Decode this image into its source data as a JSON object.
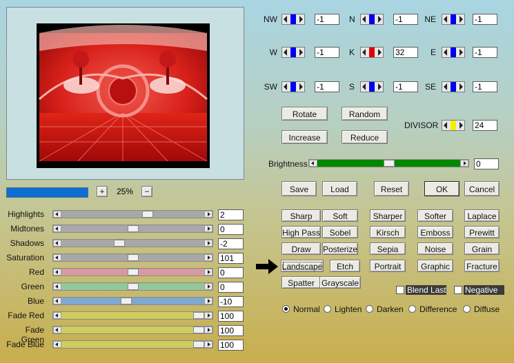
{
  "colors": {
    "accent_blue": "#0000ee",
    "center_red": "#e00000",
    "divisor_yellow": "#f4ee00",
    "brightness_green": "#008800",
    "progress_blue": "#0a6fd4",
    "slider_gray": "#a8a8a8",
    "slider_red": "#d69aa0",
    "slider_green": "#93c99a",
    "slider_blue": "#7fa8d0",
    "slider_fade": "#cfcd5c"
  },
  "preview": {
    "zoom_value": "25%",
    "zoom_plus": "+",
    "zoom_minus": "−",
    "progress": 1.0
  },
  "matrix": [
    {
      "label": "NW",
      "value": "-1",
      "thumb": "blue"
    },
    {
      "label": "N",
      "value": "-1",
      "thumb": "blue"
    },
    {
      "label": "NE",
      "value": "-1",
      "thumb": "blue"
    },
    {
      "label": "W",
      "value": "-1",
      "thumb": "blue"
    },
    {
      "label": "K",
      "value": "32",
      "thumb": "red"
    },
    {
      "label": "E",
      "value": "-1",
      "thumb": "blue"
    },
    {
      "label": "SW",
      "value": "-1",
      "thumb": "blue"
    },
    {
      "label": "S",
      "value": "-1",
      "thumb": "blue"
    },
    {
      "label": "SE",
      "value": "-1",
      "thumb": "blue"
    }
  ],
  "divisor": {
    "label": "DIVISOR",
    "value": "24"
  },
  "buttons": {
    "rotate": "Rotate",
    "random": "Random",
    "increase": "Increase",
    "reduce": "Reduce",
    "save": "Save",
    "load": "Load",
    "reset": "Reset",
    "ok": "OK",
    "cancel": "Cancel"
  },
  "brightness": {
    "label": "Brightness",
    "value": "0",
    "level": 0.5
  },
  "adjust": [
    {
      "label": "Highlights",
      "value": "2",
      "level": 0.61,
      "track": "slider_gray"
    },
    {
      "label": "Midtones",
      "value": "0",
      "level": 0.5,
      "track": "slider_gray"
    },
    {
      "label": "Shadows",
      "value": "-2",
      "level": 0.4,
      "track": "slider_gray"
    },
    {
      "label": "Saturation",
      "value": "101",
      "level": 0.5,
      "track": "slider_gray"
    },
    {
      "label": "Red",
      "value": "0",
      "level": 0.5,
      "track": "slider_red"
    },
    {
      "label": "Green",
      "value": "0",
      "level": 0.5,
      "track": "slider_green"
    },
    {
      "label": "Blue",
      "value": "-10",
      "level": 0.45,
      "track": "slider_blue"
    },
    {
      "label": "Fade Red",
      "value": "100",
      "level": 1.0,
      "track": "slider_fade"
    },
    {
      "label": "Fade Green",
      "value": "100",
      "level": 1.0,
      "track": "slider_fade"
    },
    {
      "label": "Fade Blue",
      "value": "100",
      "level": 1.0,
      "track": "slider_fade"
    }
  ],
  "presets": [
    [
      "Sharp",
      "Soft",
      "Sharper",
      "Softer",
      "Laplace"
    ],
    [
      "High Pass",
      "Sobel",
      "Kirsch",
      "Emboss",
      "Prewitt"
    ],
    [
      "Draw",
      "Posterize",
      "Sepia",
      "Noise",
      "Grain"
    ],
    [
      "Landscape",
      "Etch",
      "Portrait",
      "Graphic",
      "Fracture"
    ],
    [
      "Spatter",
      "Grayscale"
    ]
  ],
  "checks": {
    "blend_last": "Blend Last",
    "negative": "Negative"
  },
  "modes": [
    "Normal",
    "Lighten",
    "Darken",
    "Difference",
    "Diffuse"
  ],
  "selected_mode": "Normal"
}
